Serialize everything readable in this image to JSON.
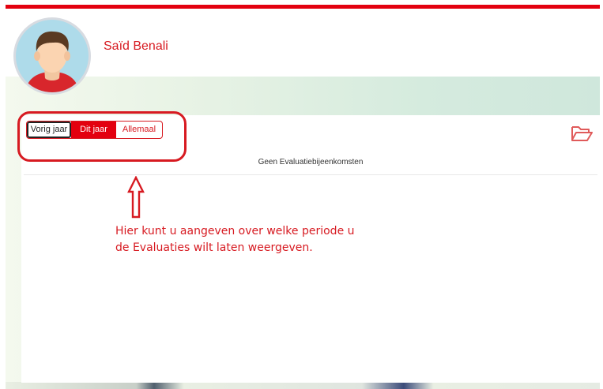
{
  "user": {
    "name": "Saïd Benali"
  },
  "filters": {
    "options": [
      "Vorig jaar",
      "Dit jaar",
      "Allemaal"
    ],
    "selected": "Dit jaar"
  },
  "results": {
    "empty_message": "Geen Evaluatiebijeenkomsten"
  },
  "annotation": {
    "line1": "Hier kunt u aangeven over welke periode u",
    "line2": "de Evaluaties wilt laten weergeven."
  },
  "icons": {
    "folder": "folder-open-icon",
    "arrow": "arrow-up-icon",
    "avatar": "user-avatar"
  },
  "colors": {
    "brand_red": "#e3000f",
    "text_red": "#d71a21",
    "avatar_bg": "#aedbea"
  }
}
